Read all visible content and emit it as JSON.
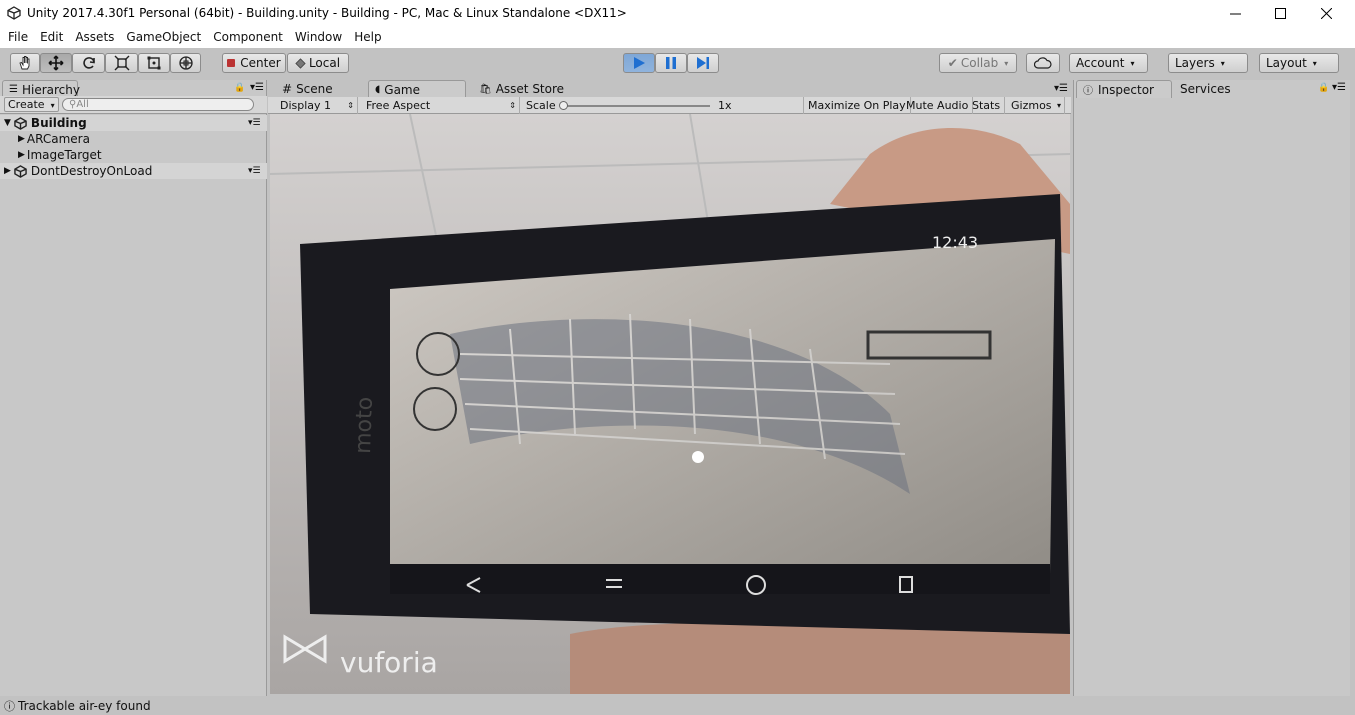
{
  "window": {
    "title": "Unity 2017.4.30f1 Personal (64bit) - Building.unity - Building - PC, Mac & Linux Standalone <DX11>"
  },
  "menu": [
    "File",
    "Edit",
    "Assets",
    "GameObject",
    "Component",
    "Window",
    "Help"
  ],
  "toolbar": {
    "pivot_label": "Center",
    "space_label": "Local",
    "collab_label": "Collab",
    "account_label": "Account",
    "layers_label": "Layers",
    "layout_label": "Layout"
  },
  "hierarchy": {
    "tab_label": "Hierarchy",
    "create_label": "Create",
    "search_placeholder": "All",
    "scene_name": "Building",
    "items": [
      "ARCamera",
      "ImageTarget"
    ],
    "dont_destroy": "DontDestroyOnLoad"
  },
  "center_tabs": [
    "Scene",
    "Game",
    "Asset Store"
  ],
  "game_toolbar": {
    "display": "Display 1",
    "aspect": "Free Aspect",
    "scale_label": "Scale",
    "scale_value": "1x",
    "maximize": "Maximize On Play",
    "mute": "Mute Audio",
    "stats": "Stats",
    "gizmos": "Gizmos"
  },
  "game_view": {
    "phone_time": "12:43",
    "watermark": "vuforia",
    "phone_brand": "moto"
  },
  "inspector": {
    "tabs": [
      "Inspector",
      "Services"
    ]
  },
  "status_bar": {
    "message": "Trackable air-ey found"
  },
  "colors": {
    "play_active": "#3d7bc9",
    "panel_bg": "#c2c2c2"
  }
}
